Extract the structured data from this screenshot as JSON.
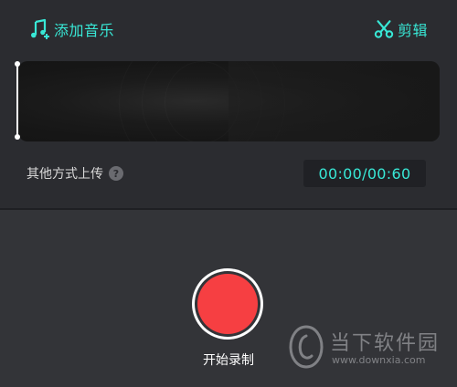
{
  "header": {
    "add_music_label": "添加音乐",
    "edit_label": "剪辑"
  },
  "upload": {
    "other_methods_label": "其他方式上传",
    "help_symbol": "?"
  },
  "timer": {
    "display": "00:00/00:60"
  },
  "recorder": {
    "start_label": "开始录制"
  },
  "watermark": {
    "site_name_cn": "当下软件园",
    "site_url": "www.downxia.com"
  },
  "icons": {
    "add_music": "music-note-plus-icon",
    "edit": "scissors-icon",
    "help": "question-circle-icon"
  },
  "colors": {
    "accent": "#38e8d6",
    "record": "#f63f42",
    "background_top": "#2b2c30",
    "background_bottom": "#333438",
    "timer_box": "#202125"
  }
}
